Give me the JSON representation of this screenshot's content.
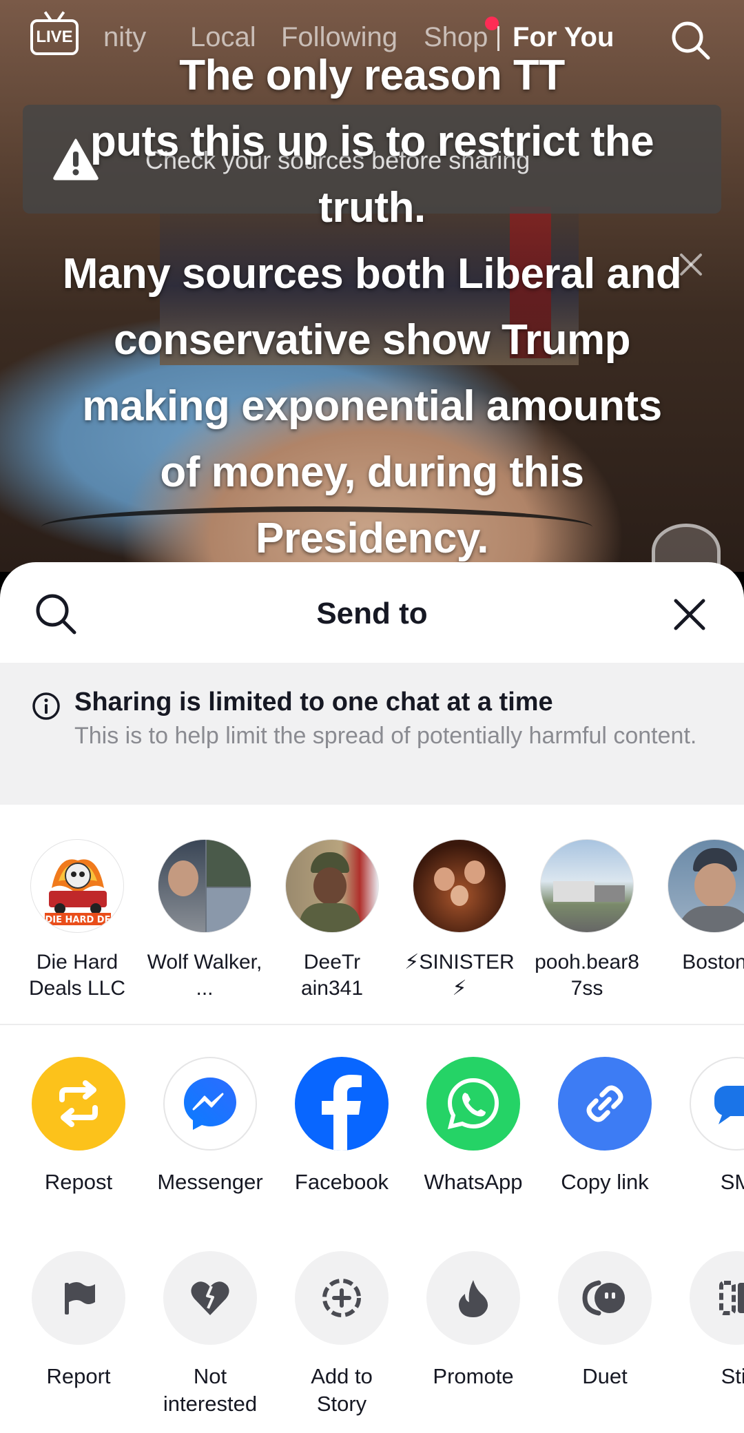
{
  "top_nav": {
    "live_label": "LIVE",
    "tabs": [
      {
        "label": "nity"
      },
      {
        "label": "Local"
      },
      {
        "label": "Following"
      },
      {
        "label": "Shop"
      },
      {
        "label": "For You"
      }
    ]
  },
  "warning_banner": {
    "text": "Check your sources before sharing"
  },
  "caption": {
    "lines": [
      "The only reason TT",
      "puts this up is to restrict the",
      "truth.",
      "Many sources both Liberal and",
      "conservative show Trump",
      "making exponential amounts",
      "of money, during this",
      "Presidency."
    ]
  },
  "sheet": {
    "title": "Send to",
    "notice_title": "Sharing is limited to one chat at a time",
    "notice_body": "This is to help limit the spread of potentially harmful content.",
    "contacts": [
      {
        "name": "Die Hard Deals LLC",
        "avatar_text": "DIE HARD DE"
      },
      {
        "name": "Wolf Walker, ..."
      },
      {
        "name": "DeeTr ain341"
      },
      {
        "name": "⚡SINISTER ⚡"
      },
      {
        "name": "pooh.bear8 7ss"
      },
      {
        "name": "Boston"
      }
    ],
    "share_apps": [
      {
        "label": "Repost",
        "icon": "repost-icon",
        "color": "#fcc21b"
      },
      {
        "label": "Messenger",
        "icon": "messenger-icon",
        "color": "#ffffff"
      },
      {
        "label": "Facebook",
        "icon": "facebook-icon",
        "color": "#0866ff"
      },
      {
        "label": "WhatsApp",
        "icon": "whatsapp-icon",
        "color": "#25d366"
      },
      {
        "label": "Copy link",
        "icon": "link-icon",
        "color": "#3d7cf4"
      },
      {
        "label": "SM",
        "icon": "sms-icon",
        "color": "#ffffff"
      }
    ],
    "actions": [
      {
        "label": "Report",
        "icon": "flag-icon"
      },
      {
        "label": "Not interested",
        "icon": "broken-heart-icon"
      },
      {
        "label": "Add to Story",
        "icon": "add-story-icon"
      },
      {
        "label": "Promote",
        "icon": "flame-icon"
      },
      {
        "label": "Duet",
        "icon": "duet-icon"
      },
      {
        "label": "Stit",
        "icon": "stitch-icon"
      }
    ]
  }
}
